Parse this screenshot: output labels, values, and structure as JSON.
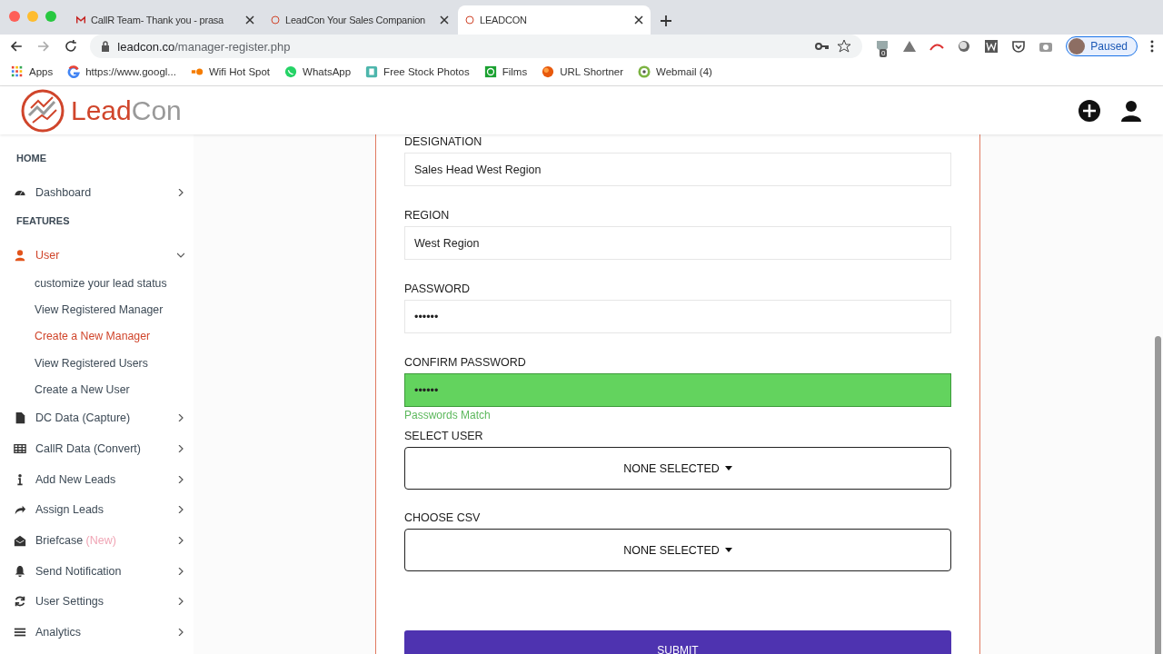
{
  "browser": {
    "tabs": [
      {
        "title": "CallR Team- Thank you - prasa",
        "selected": false
      },
      {
        "title": "LeadCon Your Sales Companion",
        "selected": false
      },
      {
        "title": "LEADCON",
        "selected": true
      }
    ],
    "url": {
      "host": "leadcon.co",
      "path": "/manager-register.php"
    },
    "extension_badge": "0",
    "profile": "Paused",
    "bookmarks": [
      "Apps",
      "https://www.googl...",
      "Wifi Hot Spot",
      "WhatsApp",
      "Free Stock Photos",
      "Films",
      "URL Shortner",
      "Webmail (4)"
    ]
  },
  "brand": {
    "first": "Lead",
    "second": "Con"
  },
  "sidebar": {
    "items": [
      {
        "kind": "section",
        "label": "HOME"
      },
      {
        "kind": "item",
        "label": "Dashboard",
        "selected": false,
        "expanded": false
      },
      {
        "kind": "section",
        "label": "FEATURES"
      },
      {
        "kind": "item",
        "label": "User",
        "selected": true,
        "expanded": true,
        "children": [
          {
            "label": "customize your lead status",
            "selected": false
          },
          {
            "label": "View Registered Manager",
            "selected": false
          },
          {
            "label": "Create a New Manager",
            "selected": true
          },
          {
            "label": "View Registered Users",
            "selected": false
          },
          {
            "label": "Create a New User",
            "selected": false
          }
        ]
      },
      {
        "kind": "item",
        "label": "DC Data (Capture)",
        "selected": false,
        "expanded": false
      },
      {
        "kind": "item",
        "label": "CallR Data (Convert)",
        "selected": false,
        "expanded": false
      },
      {
        "kind": "item",
        "label": "Add New Leads",
        "selected": false,
        "expanded": false
      },
      {
        "kind": "item",
        "label": "Assign Leads",
        "selected": false,
        "expanded": false
      },
      {
        "kind": "item",
        "label": "Briefcase",
        "badge": "(New)",
        "selected": false,
        "expanded": false
      },
      {
        "kind": "item",
        "label": "Send Notification",
        "selected": false,
        "expanded": false
      },
      {
        "kind": "item",
        "label": "User Settings",
        "selected": false,
        "expanded": false
      },
      {
        "kind": "item",
        "label": "Analytics",
        "selected": false,
        "expanded": false
      }
    ]
  },
  "form": {
    "fields": [
      {
        "kind": "text",
        "label": "DESIGNATION",
        "value": "Sales Head West Region"
      },
      {
        "kind": "text",
        "label": "REGION",
        "value": "West Region"
      },
      {
        "kind": "text",
        "label": "PASSWORD",
        "value": "••••••"
      },
      {
        "kind": "text",
        "label": "CONFIRM PASSWORD",
        "value": "••••••",
        "matched": true,
        "message": "Passwords Match"
      },
      {
        "kind": "select",
        "label": "SELECT USER",
        "value": "NONE SELECTED"
      },
      {
        "kind": "select",
        "label": "CHOOSE CSV",
        "value": "NONE SELECTED"
      }
    ],
    "submit": "SUBMIT"
  }
}
